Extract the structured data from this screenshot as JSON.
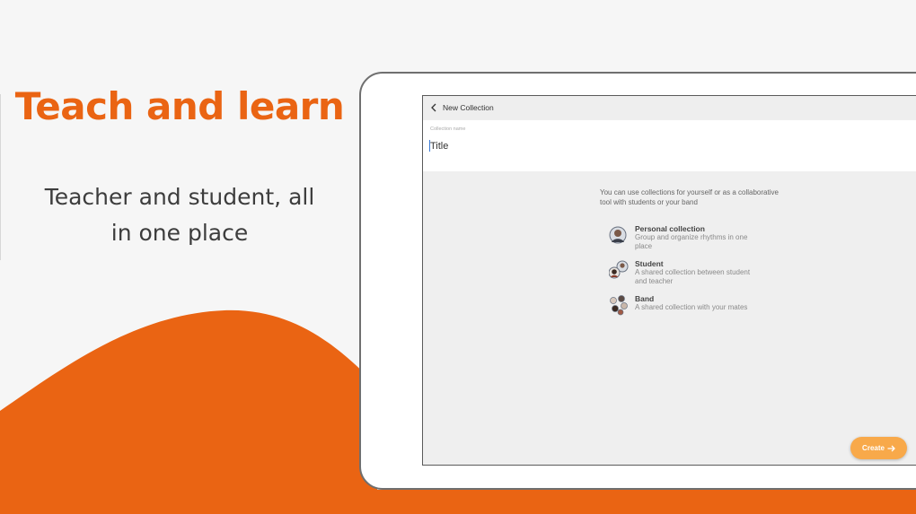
{
  "promo": {
    "headline": "Teach and learn",
    "subline": "Teacher and student, all in one place"
  },
  "app": {
    "topbar": {
      "back_icon": "chevron-left-icon",
      "title": "New Collection"
    },
    "name_field": {
      "label": "Collection name",
      "value": "Title"
    },
    "intro": "You can use collections for yourself or as a collaborative tool with students or your band",
    "options": [
      {
        "title": "Personal collection",
        "description": "Group and organize rhythms in one place",
        "icon": "single-avatar-icon"
      },
      {
        "title": "Student",
        "description": "A shared collection between student and teacher",
        "icon": "two-avatars-icon"
      },
      {
        "title": "Band",
        "description": "A shared collection with your mates",
        "icon": "group-avatars-icon"
      }
    ],
    "create_button": {
      "label": "Create",
      "icon": "arrow-right-icon"
    }
  },
  "colors": {
    "accent": "#ea6413",
    "button": "#f8a94a",
    "background": "#f6f6f6"
  }
}
